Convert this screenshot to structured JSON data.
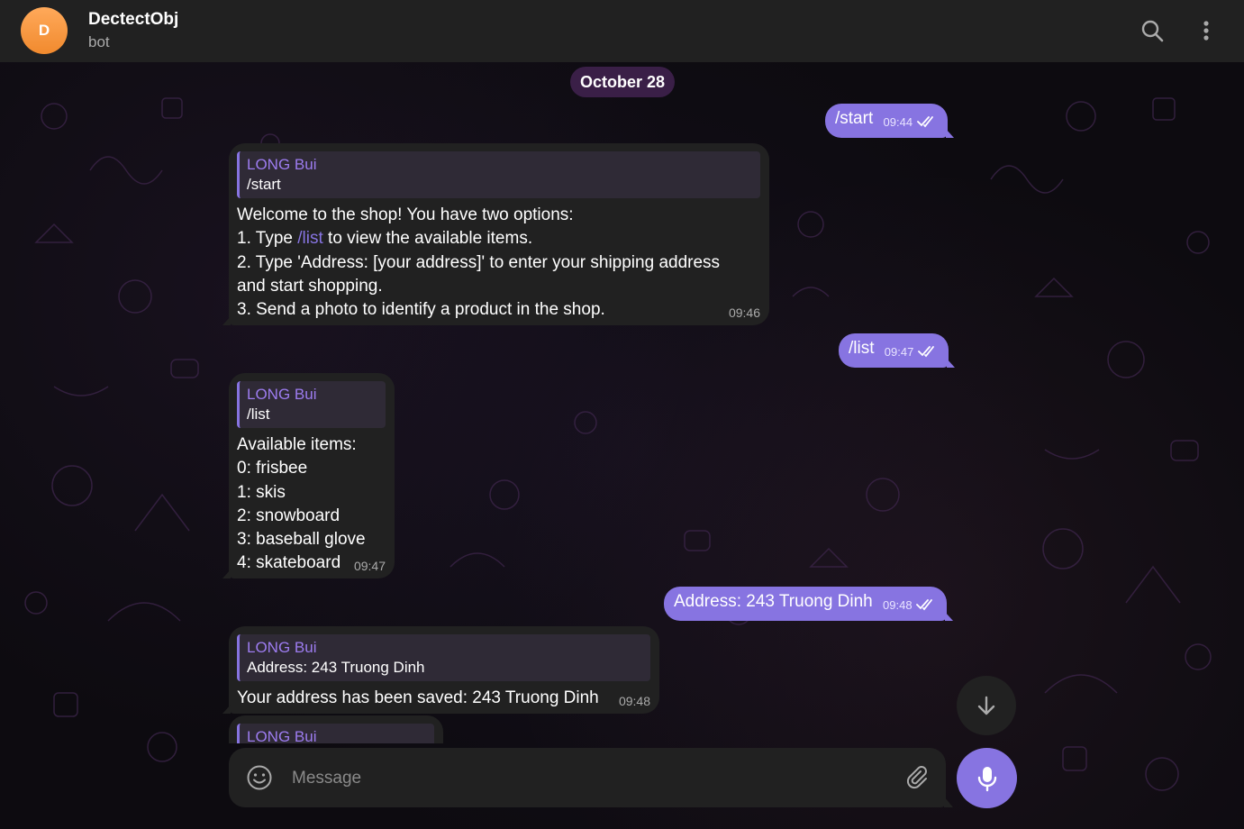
{
  "header": {
    "avatar_letter": "D",
    "title": "DectectObj",
    "subtitle": "bot",
    "icons": [
      "search-icon",
      "more-vertical-icon"
    ]
  },
  "date_chip": "October 28",
  "messages": [
    {
      "dir": "out",
      "text": "/start",
      "time": "09:44",
      "status": "read"
    },
    {
      "dir": "in",
      "reply_name": "LONG Bui",
      "reply_text": "/start",
      "lines": [
        "Welcome to the shop! You have two options:",
        "1. Type ",
        "/list",
        " to view the available items.",
        "2. Type 'Address: [your address]' to enter your shipping address",
        "and start shopping.",
        "3. Send a photo to identify a product in the shop."
      ],
      "time": "09:46"
    },
    {
      "dir": "out",
      "text": "/list",
      "time": "09:47",
      "status": "read"
    },
    {
      "dir": "in",
      "reply_name": "LONG Bui",
      "reply_text": "/list",
      "lines": [
        "Available items:",
        "0: frisbee",
        "1: skis",
        "2: snowboard",
        "3: baseball glove",
        "4: skateboard"
      ],
      "time": "09:47"
    },
    {
      "dir": "out",
      "text": "Address: 243 Truong Dinh",
      "time": "09:48",
      "status": "read"
    },
    {
      "dir": "in",
      "reply_name": "LONG Bui",
      "reply_text": "Address: 243 Truong Dinh",
      "lines": [
        "Your address has been saved: 243 Truong Dinh"
      ],
      "time": "09:48"
    },
    {
      "dir": "in",
      "reply_name": "LONG Bui",
      "partial": true
    }
  ],
  "composer": {
    "placeholder": "Message"
  },
  "colors": {
    "accent": "#8774e1",
    "header_bg": "#212121",
    "bubble_in": "#212121",
    "date_chip": "#3a1f47",
    "avatar": "#f39a45"
  }
}
